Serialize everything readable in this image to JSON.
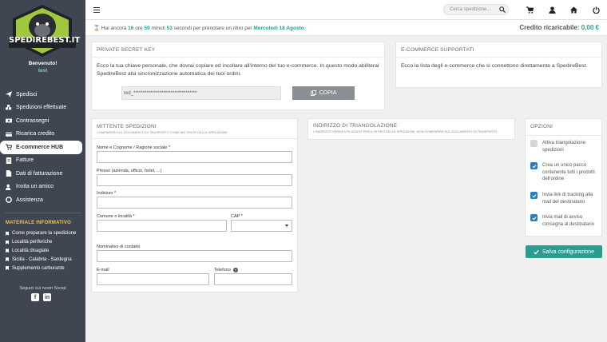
{
  "brand": {
    "name": "SPEDIREBEST.IT",
    "accent": "#2a9d8f"
  },
  "user": {
    "welcome": "Benvenuto!",
    "username": "test"
  },
  "sidebar": {
    "items": [
      {
        "label": "Spedisci",
        "icon": "paper-plane-icon"
      },
      {
        "label": "Spedizioni effettuate",
        "icon": "boxes-icon"
      },
      {
        "label": "Contrassegni",
        "icon": "money-icon"
      },
      {
        "label": "Ricarica credito",
        "icon": "credit-card-icon"
      },
      {
        "label": "E-commerce HUB",
        "icon": "cart-icon"
      },
      {
        "label": "Fatture",
        "icon": "invoice-icon"
      },
      {
        "label": "Dati di fatturazione",
        "icon": "document-icon"
      },
      {
        "label": "Invita un amico",
        "icon": "user-plus-icon"
      },
      {
        "label": "Assistenza",
        "icon": "lifebuoy-icon"
      }
    ],
    "active_index": 4,
    "info_title": "MATERIALE INFORMATIVO",
    "info_items": [
      "Come preparare la spedizione",
      "Località periferiche",
      "Località disagiate",
      "Sicilia - Calabria - Sardegna",
      "Supplemento carburante"
    ],
    "social_text": "Seguici sui nostri Social"
  },
  "topbar": {
    "search_placeholder": "Cerca spedizione..."
  },
  "strip": {
    "prefix": "Hai ancora",
    "hours": "16",
    "hours_label": "ore",
    "minutes": "59",
    "minutes_label": "minuti",
    "seconds": "53",
    "seconds_label": "secondi",
    "middle": "per prenotare un ritiro per",
    "date": "Mercoledì 18 Agosto",
    "credit_label": "Credito ricaricabile:",
    "credit_value": "0,00 €"
  },
  "secret": {
    "title": "PRIVATE SECRET KEY",
    "text": "Ecco la tua chiave personale, che dovrai copiare ed incollare all'interno del tuo e-commerce. In questo modo abiliterai SpedireBest alla sincronizzazione automatica dei tuoi ordini.",
    "key": "red_**********************************",
    "copy_label": "COPIA"
  },
  "ecommerce": {
    "title": "E-COMMERCE SUPPORTATI",
    "text": "Ecco la lista degli e-commerce che si connettono direttamente a SpedireBest."
  },
  "mittente": {
    "title": "MITTENTE SPEDIZIONI",
    "subtitle": "COMPARIRÀ SUL DOCUMENTO DI TRASPORTO COME MITTENTE DELLA SPEDIZIONE",
    "fields": {
      "name": "Nome e Cognome / Ragione sociale *",
      "address": "Presso (azienda, ufficio, hotel, ...)",
      "street": "Indirizzo *",
      "city": "Comune o località *",
      "cap": "CAP *",
      "contact": "Nominativo di contatto",
      "email": "E-mail",
      "phone": "Telefono"
    }
  },
  "triangolazione": {
    "title": "INDIRIZZO DI TRIANGOLAZIONE",
    "subtitle": "L'INDIRIZZO VERRÀ UTILIZZATO PER IL RITIRO DELLE SPEDIZIONI, NON COMPARIRÀ SUL DOCUMENTO DI TRASPORTO"
  },
  "opzioni": {
    "title": "OPZIONI",
    "items": [
      {
        "label": "Attiva triangolazione spedizioni",
        "checked": false
      },
      {
        "label": "Crea un unico pacco contenente tutti i prodotti dell'ordine",
        "checked": true
      },
      {
        "label": "Invia link di tracking alla mail del destinatario",
        "checked": true
      },
      {
        "label": "Invia mail di avviso consegna al destinatario",
        "checked": true
      }
    ],
    "save_label": "Salva configurazione"
  }
}
